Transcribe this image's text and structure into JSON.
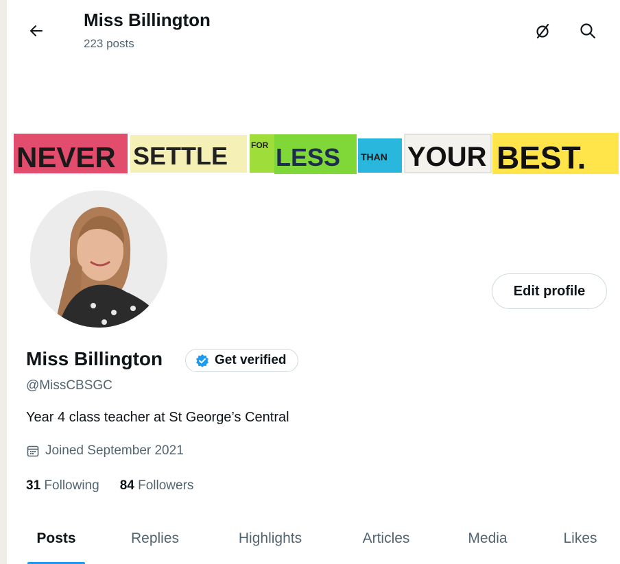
{
  "header": {
    "title": "Miss Billington",
    "post_count": "223 posts",
    "icons": {
      "back": "arrow-left-icon",
      "hide": "slash-circle-icon",
      "search": "search-icon"
    }
  },
  "banner": {
    "words": [
      "NEVER",
      "SETTLE",
      "FOR",
      "LESS",
      "THAN",
      "YOUR",
      "BEST."
    ],
    "colors": [
      "#e24d6e",
      "#f5f0b5",
      "#9fdd3b",
      "#80d838",
      "#29b7de",
      "#f4f2ec",
      "#ffe54a"
    ]
  },
  "profile": {
    "edit_label": "Edit profile",
    "display_name": "Miss Billington",
    "verified_label": "Get verified",
    "handle": "@MissCBSGC",
    "bio": "Year 4 class teacher at St George’s Central",
    "joined": "Joined September 2021",
    "following_count": "31",
    "following_label": "Following",
    "followers_count": "84",
    "followers_label": "Followers"
  },
  "tabs": [
    "Posts",
    "Replies",
    "Highlights",
    "Articles",
    "Media",
    "Likes"
  ],
  "colors": {
    "accent": "#1d9bf0",
    "text": "#0f1419",
    "secondary": "#536471"
  }
}
